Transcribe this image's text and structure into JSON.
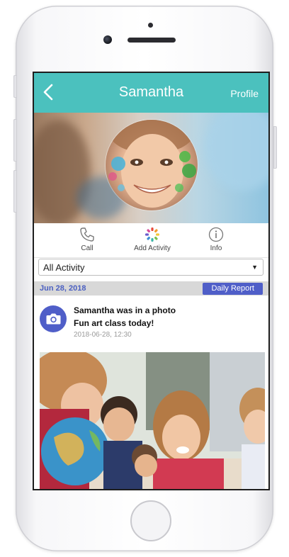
{
  "header": {
    "title": "Samantha",
    "right_label": "Profile"
  },
  "actions": [
    {
      "label": "Call",
      "icon": "phone-icon"
    },
    {
      "label": "Add Activity",
      "icon": "pinwheel-icon"
    },
    {
      "label": "Info",
      "icon": "info-icon"
    }
  ],
  "filter": {
    "selected": "All Activity",
    "caret": "▼"
  },
  "feed": {
    "date": "Jun 28, 2018",
    "report_button": "Daily Report",
    "post": {
      "title": "Samantha was in a photo",
      "caption": "Fun art class today!",
      "timestamp": "2018-06-28, 12:30",
      "icon": "camera-icon"
    }
  },
  "colors": {
    "header": "#4bc1be",
    "accent": "#4f5ec8",
    "date_text": "#4a5fc1"
  }
}
